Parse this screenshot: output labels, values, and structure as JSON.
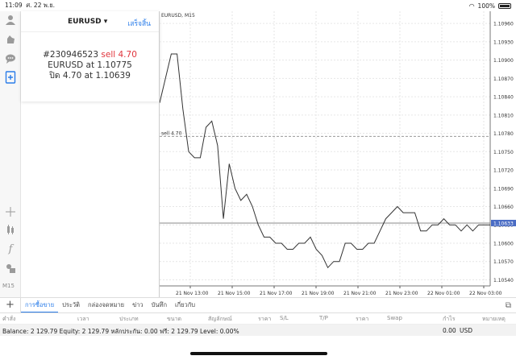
{
  "status_bar": {
    "time": "11:09",
    "date": "ศ. 22 พ.ย.",
    "battery": "100%"
  },
  "panel": {
    "symbol": "EURUSD",
    "dropdown_arrow": "▾",
    "done_label": "เสร็จสิ้น",
    "ticket": "#230946523",
    "action": "sell 4.70",
    "line2": "EURUSD at 1.10775",
    "line3": "ปิด 4.70 at 1.10639"
  },
  "chart": {
    "header": "EURUSD, M15",
    "order_line_label": "sell 4.70",
    "current_price": "1.10633"
  },
  "chart_data": {
    "type": "line",
    "title": "EURUSD, M15",
    "x": [
      "21 Nov 13:00",
      "21 Nov 15:00",
      "21 Nov 17:00",
      "21 Nov 19:00",
      "21 Nov 21:00",
      "21 Nov 23:00",
      "22 Nov 01:00",
      "22 Nov 03:00"
    ],
    "y_ticks": [
      "1.10960",
      "1.10930",
      "1.10900",
      "1.10870",
      "1.10840",
      "1.10810",
      "1.10780",
      "1.10750",
      "1.10720",
      "1.10690",
      "1.10660",
      "1.10630",
      "1.10600",
      "1.10570",
      "1.10540"
    ],
    "ylim": [
      1.1053,
      1.1098
    ],
    "order_line": 1.10775,
    "current": 1.10633,
    "series": [
      {
        "values": [
          1.1083,
          1.1087,
          1.1091,
          1.1091,
          1.1082,
          1.1075,
          1.1074,
          1.1074,
          1.1079,
          1.108,
          1.1076,
          1.1064,
          1.1073,
          1.1069,
          1.1067,
          1.1068,
          1.1066,
          1.1063,
          1.1061,
          1.1061,
          1.106,
          1.106,
          1.1059,
          1.1059,
          1.106,
          1.106,
          1.1061,
          1.1059,
          1.1058,
          1.1056,
          1.1057,
          1.1057,
          1.106,
          1.106,
          1.1059,
          1.1059,
          1.106,
          1.106,
          1.1062,
          1.1064,
          1.1065,
          1.1066,
          1.1065,
          1.1065,
          1.1065,
          1.1062,
          1.1062,
          1.1063,
          1.1063,
          1.1064,
          1.1063,
          1.1063,
          1.1062,
          1.1063,
          1.1062,
          1.1063,
          1.1063,
          1.1063
        ]
      }
    ]
  },
  "left_toolbar": {
    "icons": [
      "person-icon",
      "hand-icon",
      "chat-icon",
      "new-order-icon",
      "crosshair-icon",
      "indicators-icon",
      "function-icon",
      "objects-icon"
    ],
    "timeframe": "M15"
  },
  "tabs": [
    "การซื้อขาย",
    "ประวัติ",
    "กล่องจดหมาย",
    "ข่าว",
    "บันทึก",
    "เกี่ยวกับ"
  ],
  "columns": [
    "คำสั่ง",
    "เวลา",
    "ประเภท",
    "ขนาด",
    "สัญลักษณ์",
    "ราคา",
    "S/L",
    "T/P",
    "ราคา",
    "Swap",
    "กำไร",
    "หมายเหตุ"
  ],
  "balance": {
    "text": "Balance: 2 129.79 Equity: 2 129.79 หลักประกัน: 0.00 ฟรี: 2 129.79 Level: 0.00%",
    "value": "0.00",
    "currency": "USD"
  }
}
